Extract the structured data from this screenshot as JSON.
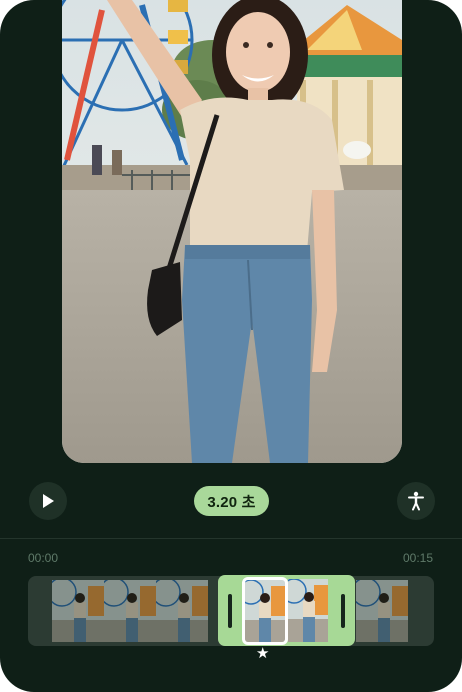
{
  "controls": {
    "play_icon": "play-icon",
    "timestamp_pill": "3.20 초",
    "accessibility_icon": "accessibility-icon"
  },
  "timeline": {
    "start_time": "00:00",
    "end_time": "00:15"
  },
  "colors": {
    "background": "#0f1f17",
    "accent": "#a9d89a",
    "button": "#1f3127"
  }
}
